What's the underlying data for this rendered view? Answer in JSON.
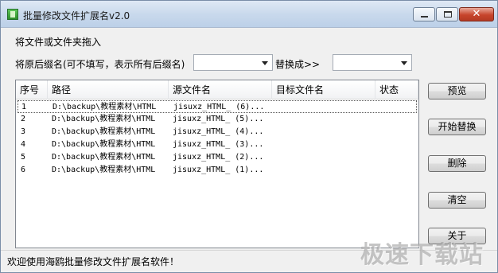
{
  "window": {
    "title": "批量修改文件扩展名v2.0",
    "close_glyph": "✕"
  },
  "form": {
    "drag_hint": "将文件或文件夹拖入",
    "ext_label": "将原后缀名(可不填写，表示所有后缀名)",
    "ext_value": "",
    "replace_label": "替换成>>",
    "replace_value": ""
  },
  "table": {
    "columns": [
      "序号",
      "路径",
      "源文件名",
      "目标文件名",
      "状态"
    ],
    "rows": [
      {
        "no": "1",
        "path": "D:\\backup\\教程素材\\HTML",
        "source": "jisuxz_HTML_ (6)..."
      },
      {
        "no": "2",
        "path": "D:\\backup\\教程素材\\HTML",
        "source": "jisuxz_HTML_ (5)..."
      },
      {
        "no": "3",
        "path": "D:\\backup\\教程素材\\HTML",
        "source": "jisuxz_HTML_ (4)..."
      },
      {
        "no": "4",
        "path": "D:\\backup\\教程素材\\HTML",
        "source": "jisuxz_HTML_ (3)..."
      },
      {
        "no": "5",
        "path": "D:\\backup\\教程素材\\HTML",
        "source": "jisuxz_HTML_ (2)..."
      },
      {
        "no": "6",
        "path": "D:\\backup\\教程素材\\HTML",
        "source": "jisuxz_HTML_ (1)..."
      }
    ]
  },
  "buttons": {
    "preview": "预览",
    "start": "开始替换",
    "delete": "删除",
    "clear": "清空",
    "close": "关于"
  },
  "status": {
    "text": "欢迎使用海鸥批量修改文件扩展名软件！"
  },
  "watermark": "极速下载站"
}
